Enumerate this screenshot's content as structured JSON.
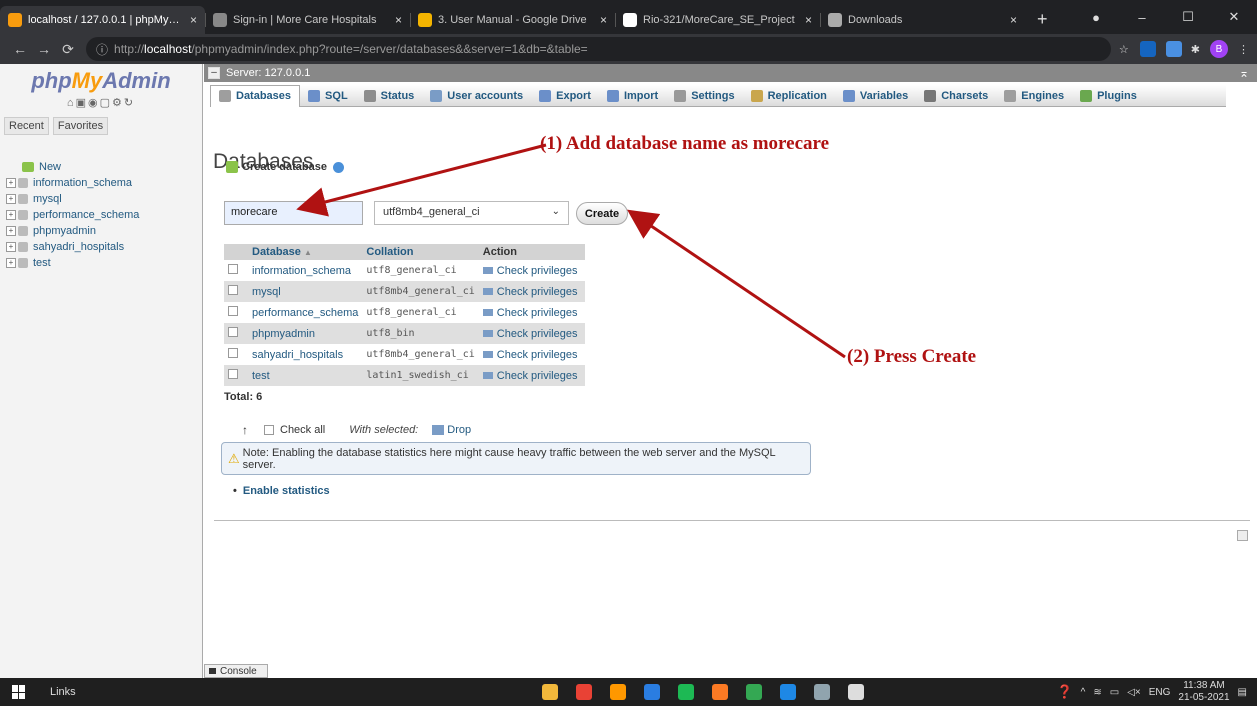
{
  "browser": {
    "tabs": [
      {
        "title": "localhost / 127.0.0.1 | phpMyAdmin",
        "icon": "phpmyadmin-favicon",
        "color": "#f89c0e",
        "active": true
      },
      {
        "title": "Sign-in | More Care Hospitals",
        "icon": "globe-favicon",
        "color": "#888888"
      },
      {
        "title": "3. User Manual - Google Drive",
        "icon": "google-drive-favicon",
        "color": "#f4b400"
      },
      {
        "title": "Rio-321/MoreCare_SE_Project",
        "icon": "github-favicon",
        "color": "#ffffff"
      },
      {
        "title": "Downloads",
        "icon": "download-favicon",
        "color": "#aaaaaa"
      }
    ],
    "url_prefix": "http://",
    "url_host": "localhost",
    "url_path": "/phpmyadmin/index.php?route=/server/databases&&server=1&db=&table=",
    "profile_initial": "B"
  },
  "sidebar": {
    "logo_php": "php",
    "logo_my": "My",
    "logo_admin": "Admin",
    "recent_label": "Recent",
    "favorites_label": "Favorites",
    "new_label": "New",
    "databases": [
      "information_schema",
      "mysql",
      "performance_schema",
      "phpmyadmin",
      "sahyadri_hospitals",
      "test"
    ]
  },
  "server_bar": {
    "label": "Server: 127.0.0.1"
  },
  "menu": [
    {
      "label": "Databases",
      "icon": "database-icon",
      "color": "#9e9e9e",
      "active": true
    },
    {
      "label": "SQL",
      "icon": "sql-icon",
      "color": "#6b8fc9"
    },
    {
      "label": "Status",
      "icon": "status-icon",
      "color": "#8d8d8d"
    },
    {
      "label": "User accounts",
      "icon": "users-icon",
      "color": "#7a9cc6"
    },
    {
      "label": "Export",
      "icon": "export-icon",
      "color": "#6b8fc9"
    },
    {
      "label": "Import",
      "icon": "import-icon",
      "color": "#6b8fc9"
    },
    {
      "label": "Settings",
      "icon": "settings-icon",
      "color": "#999999"
    },
    {
      "label": "Replication",
      "icon": "replication-icon",
      "color": "#c9a64d"
    },
    {
      "label": "Variables",
      "icon": "variables-icon",
      "color": "#6b8fc9"
    },
    {
      "label": "Charsets",
      "icon": "charsets-icon",
      "color": "#777777"
    },
    {
      "label": "Engines",
      "icon": "engines-icon",
      "color": "#9e9e9e"
    },
    {
      "label": "Plugins",
      "icon": "plugins-icon",
      "color": "#6aa84f"
    }
  ],
  "page": {
    "title": "Databases",
    "create_label": "Create database",
    "db_name_value": "morecare",
    "collation_value": "utf8mb4_general_ci",
    "create_button": "Create"
  },
  "table": {
    "headers": {
      "database": "Database",
      "collation": "Collation",
      "action": "Action"
    },
    "rows": [
      {
        "name": "information_schema",
        "collation": "utf8_general_ci",
        "action": "Check privileges"
      },
      {
        "name": "mysql",
        "collation": "utf8mb4_general_ci",
        "action": "Check privileges"
      },
      {
        "name": "performance_schema",
        "collation": "utf8_general_ci",
        "action": "Check privileges"
      },
      {
        "name": "phpmyadmin",
        "collation": "utf8_bin",
        "action": "Check privileges"
      },
      {
        "name": "sahyadri_hospitals",
        "collation": "utf8mb4_general_ci",
        "action": "Check privileges"
      },
      {
        "name": "test",
        "collation": "latin1_swedish_ci",
        "action": "Check privileges"
      }
    ],
    "total": "Total: 6"
  },
  "bulk": {
    "check_all": "Check all",
    "with_selected": "With selected:",
    "drop": "Drop"
  },
  "note": "Note: Enabling the database statistics here might cause heavy traffic between the web server and the MySQL server.",
  "enable_stats": "Enable statistics",
  "console": "Console",
  "annotations": {
    "step1": "(1) Add database name as morecare",
    "step2": "(2) Press Create",
    "color": "#b01212"
  },
  "taskbar": {
    "links": "Links",
    "lang": "ENG",
    "time": "11:38 AM",
    "date": "21-05-2021",
    "apps": [
      {
        "icon": "file-explorer-icon",
        "color": "#f2b83b"
      },
      {
        "icon": "chrome-icon",
        "color": "#e94235"
      },
      {
        "icon": "sublime-icon",
        "color": "#ff9800"
      },
      {
        "icon": "trello-icon",
        "color": "#2a7de1"
      },
      {
        "icon": "spotify-icon",
        "color": "#1db954"
      },
      {
        "icon": "xampp-icon",
        "color": "#fb7a24"
      },
      {
        "icon": "chrome-profile-icon",
        "color": "#34a853"
      },
      {
        "icon": "vscode-icon",
        "color": "#1e88e5"
      },
      {
        "icon": "notepad-icon",
        "color": "#90a4ae"
      },
      {
        "icon": "obs-icon",
        "color": "#dddddd"
      }
    ]
  }
}
